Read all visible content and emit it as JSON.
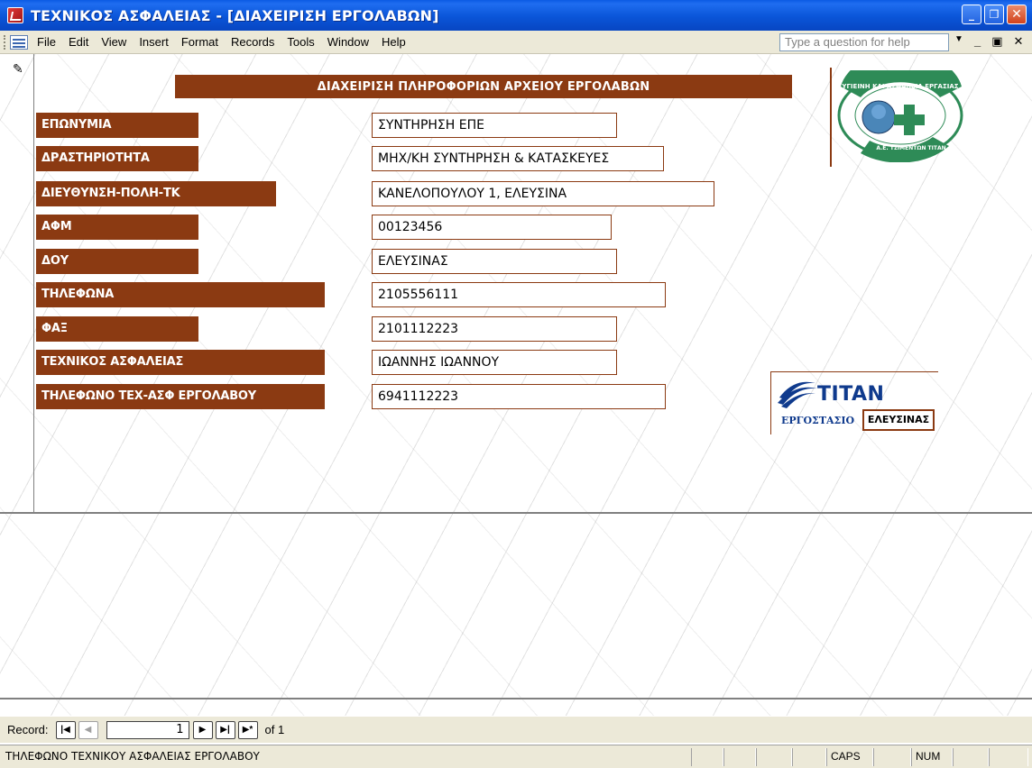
{
  "window": {
    "title": "ΤΕΧΝΙΚΟΣ ΑΣΦΑΛΕΙΑΣ - [ΔΙΑΧΕΙΡΙΣΗ ΕΡΓΟΛΑΒΩΝ]",
    "minimize": "_",
    "restore": "❐",
    "close": "✕"
  },
  "menu": {
    "items": [
      "File",
      "Edit",
      "View",
      "Insert",
      "Format",
      "Records",
      "Tools",
      "Window",
      "Help"
    ],
    "help_placeholder": "Type a question for help",
    "mdi_min": "_",
    "mdi_restore": "▣",
    "mdi_close": "✕"
  },
  "form": {
    "header": "ΔΙΑΧΕΙΡΙΣΗ ΠΛΗΡΟΦΟΡΙΩΝ ΑΡΧΕΙΟΥ ΕΡΓΟΛΑΒΩΝ",
    "fields": [
      {
        "label": "ΕΠΩΝΥΜΙΑ",
        "value": "ΣΥΝΤΗΡΗΣΗ ΕΠΕ"
      },
      {
        "label": "ΔΡΑΣΤΗΡΙΟΤΗΤΑ",
        "value": "ΜΗΧ/ΚΗ ΣΥΝΤΗΡΗΣΗ & ΚΑΤΑΣΚΕΥΕΣ"
      },
      {
        "label": "ΔΙΕΥΘΥΝΣΗ-ΠΟΛΗ-ΤΚ",
        "value": "ΚΑΝΕΛΟΠΟΥΛΟΥ 1, ΕΛΕΥΣΙΝΑ"
      },
      {
        "label": "ΑΦΜ",
        "value": "00123456"
      },
      {
        "label": "ΔΟΥ",
        "value": "ΕΛΕΥΣΙΝΑΣ"
      },
      {
        "label": "ΤΗΛΕΦΩΝΑ",
        "value": "2105556111"
      },
      {
        "label": "ΦΑΞ",
        "value": "2101112223"
      },
      {
        "label": "ΤΕΧΝΙΚΟΣ ΑΣΦΑΛΕΙΑΣ",
        "value": " ΙΩΑΝΝΗΣ ΙΩΑΝΝΟΥ"
      },
      {
        "label": "ΤΗΛΕΦΩΝΟ ΤΕΧ-ΑΣΦ ΕΡΓΟΛΑΒΟΥ",
        "value": "6941112223"
      }
    ],
    "safety_logo_text": "ΥΓΙΕΙΝΗ ΚΑΙ ΑΣΦΑΛΕΙΑ ΕΡΓΑΣΙΑΣ",
    "safety_logo_sub": "Α.Ε. ΤΣΙΜΕΝΤΩΝ ΤΙΤΑΝ",
    "titan_word": "TITAN",
    "factory_label": "ΕΡΓΟΣΤΑΣΙΟ",
    "factory_value": "ΕΛΕΥΣΙΝΑΣ"
  },
  "navigation": {
    "record_label": "Record:",
    "current": "1",
    "of_label": "of 1",
    "first": "|◀",
    "prev": "◀",
    "next": "▶",
    "last": "▶|",
    "new": "▶*"
  },
  "status": {
    "text": "ΤΗΛΕΦΩΝΟ ΤΕΧΝΙΚΟΥ ΑΣΦΑΛΕΙΑΣ ΕΡΓΟΛΑΒΟΥ",
    "caps": "CAPS",
    "num": "NUM"
  },
  "colors": {
    "label_bg": "#8b3a12",
    "titlebar": "#0a55d8",
    "chrome": "#ece9d8",
    "titan_blue": "#0f3a8d",
    "logo_green": "#2e8b57"
  }
}
